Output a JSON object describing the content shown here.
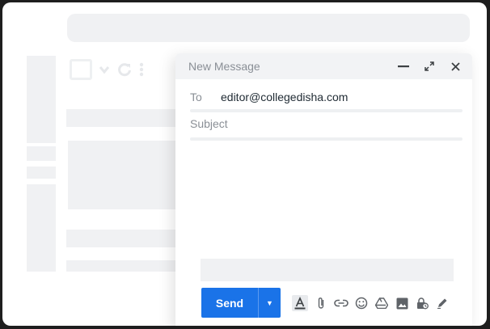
{
  "compose": {
    "title": "New Message",
    "to_label": "To",
    "to_value": "editor@collegedisha.com",
    "subject_placeholder": "Subject"
  },
  "actions": {
    "send_label": "Send",
    "send_more_glyph": "▼"
  },
  "header_icons": [
    "minimize-icon",
    "expand-icon",
    "close-icon"
  ],
  "toolbar_icons": [
    "text-format-icon",
    "attachment-icon",
    "link-icon",
    "emoji-icon",
    "drive-icon",
    "photo-icon",
    "confidential-mode-icon",
    "signature-icon"
  ],
  "colors": {
    "send_button": "#1a73e8",
    "header_bg": "#f2f3f5",
    "placeholder_gray": "#f0f1f3"
  }
}
